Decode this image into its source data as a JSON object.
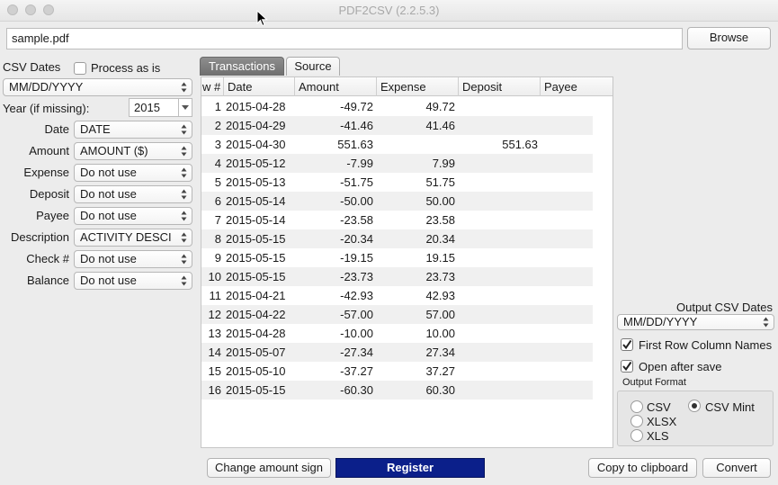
{
  "window": {
    "title": "PDF2CSV (2.2.5.3)"
  },
  "file": {
    "path": "sample.pdf",
    "browse_label": "Browse"
  },
  "left": {
    "csv_dates_label": "CSV Dates",
    "process_as_is_label": "Process as is",
    "date_format": "MM/DD/YYYY",
    "year_label": "Year (if missing):",
    "year_value": "2015",
    "fields": [
      {
        "label": "Date",
        "value": "DATE"
      },
      {
        "label": "Amount",
        "value": "AMOUNT ($)"
      },
      {
        "label": "Expense",
        "value": "Do not use"
      },
      {
        "label": "Deposit",
        "value": "Do not use"
      },
      {
        "label": "Payee",
        "value": "Do not use"
      },
      {
        "label": "Description",
        "value": "ACTIVITY DESCI"
      },
      {
        "label": "Check #",
        "value": "Do not use"
      },
      {
        "label": "Balance",
        "value": "Do not use"
      }
    ]
  },
  "tabs": [
    {
      "label": "Transactions",
      "active": true
    },
    {
      "label": "Source",
      "active": false
    }
  ],
  "table": {
    "columns": [
      "w #",
      "Date",
      "Amount",
      "Expense",
      "Deposit",
      "Payee"
    ],
    "rows": [
      [
        "1",
        "2015-04-28",
        "-49.72",
        "49.72",
        ""
      ],
      [
        "2",
        "2015-04-29",
        "-41.46",
        "41.46",
        ""
      ],
      [
        "3",
        "2015-04-30",
        "551.63",
        "",
        "551.63"
      ],
      [
        "4",
        "2015-05-12",
        "-7.99",
        "7.99",
        ""
      ],
      [
        "5",
        "2015-05-13",
        "-51.75",
        "51.75",
        ""
      ],
      [
        "6",
        "2015-05-14",
        "-50.00",
        "50.00",
        ""
      ],
      [
        "7",
        "2015-05-14",
        "-23.58",
        "23.58",
        ""
      ],
      [
        "8",
        "2015-05-15",
        "-20.34",
        "20.34",
        ""
      ],
      [
        "9",
        "2015-05-15",
        "-19.15",
        "19.15",
        ""
      ],
      [
        "10",
        "2015-05-15",
        "-23.73",
        "23.73",
        ""
      ],
      [
        "11",
        "2015-04-21",
        "-42.93",
        "42.93",
        ""
      ],
      [
        "12",
        "2015-04-22",
        "-57.00",
        "57.00",
        ""
      ],
      [
        "13",
        "2015-04-28",
        "-10.00",
        "10.00",
        ""
      ],
      [
        "14",
        "2015-05-07",
        "-27.34",
        "27.34",
        ""
      ],
      [
        "15",
        "2015-05-10",
        "-37.27",
        "37.27",
        ""
      ],
      [
        "16",
        "2015-05-15",
        "-60.30",
        "60.30",
        ""
      ]
    ]
  },
  "right": {
    "output_dates_label": "Output CSV Dates",
    "output_date_format": "MM/DD/YYYY",
    "first_row_label": "First Row Column Names",
    "first_row_checked": true,
    "open_after_save_label": "Open after save",
    "open_after_save_checked": true,
    "output_format_label": "Output Format",
    "formats": {
      "csv": "CSV",
      "csv_mint": "CSV Mint",
      "xlsx": "XLSX",
      "xls": "XLS"
    },
    "selected_format": "CSV Mint"
  },
  "bottom": {
    "change_sign_label": "Change amount sign",
    "register_label": "Register",
    "copy_label": "Copy to clipboard",
    "convert_label": "Convert"
  },
  "colors": {
    "register_bg": "#0b1f8a",
    "active_tab": "#7c7c7c"
  }
}
